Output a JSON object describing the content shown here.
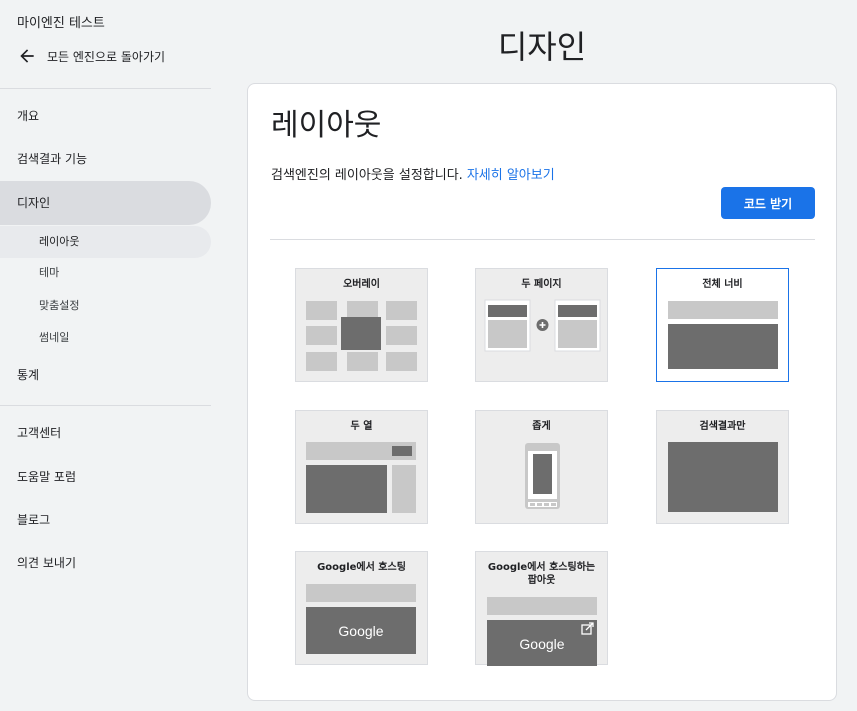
{
  "sidebar": {
    "engine_name": "마이엔진 테스트",
    "back_label": "모든 엔진으로 돌아가기",
    "nav": {
      "overview": "개요",
      "search_features": "검색결과 기능",
      "design": "디자인",
      "layout": "레이아웃",
      "theme": "테마",
      "customize": "맞춤설정",
      "thumbnail": "썸네일",
      "stats": "통계",
      "help_center": "고객센터",
      "help_forum": "도움말 포럼",
      "blog": "블로그",
      "feedback": "의견 보내기"
    }
  },
  "main": {
    "page_title": "디자인",
    "card_title": "레이아웃",
    "description": "검색엔진의 레이아웃을 설정합니다.",
    "learn_more": "자세히 알아보기",
    "code_button": "코드 받기"
  },
  "layouts": {
    "overlay": "오버레이",
    "two_page": "두 페이지",
    "full_width": "전체 너비",
    "two_column": "두 열",
    "compact": "좁게",
    "results_only": "검색결과만",
    "google_hosted": "Google에서 호스팅",
    "google_hosted_popup": "Google에서 호스팅하는 팝아웃",
    "google_logo": "Google",
    "selected": "full_width"
  },
  "colors": {
    "accent": "#1a73e8",
    "sidebar_active": "#dadce0",
    "tile_bg": "#ededed",
    "dark_block": "#6d6d6d",
    "light_block": "#c8c8c8"
  }
}
